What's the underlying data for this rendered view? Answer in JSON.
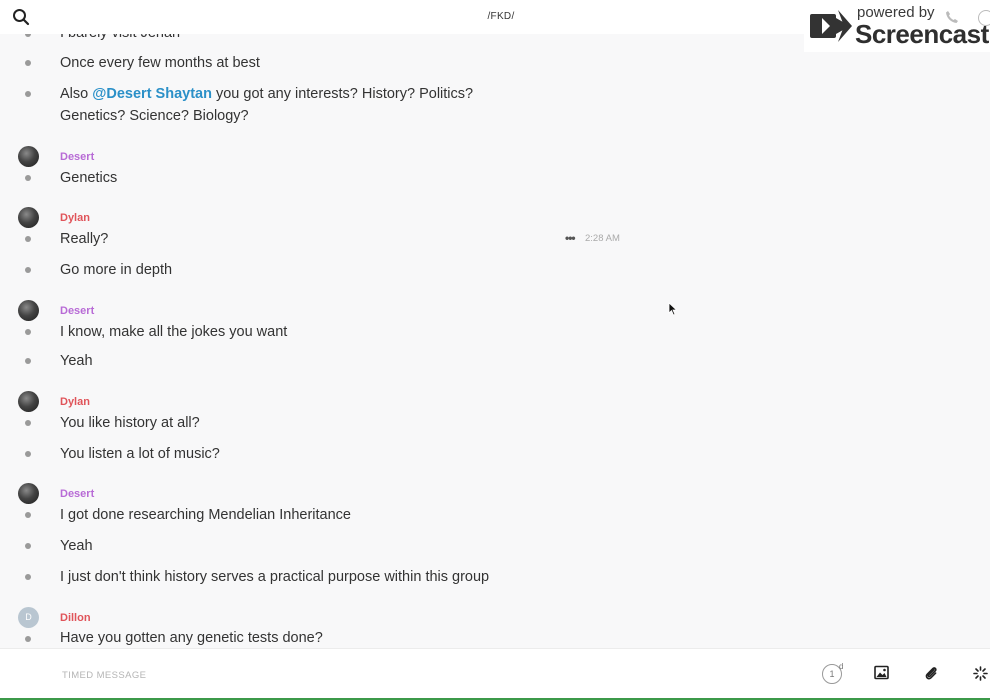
{
  "header": {
    "title": "/FKD/",
    "search_icon": "search-icon"
  },
  "watermark": {
    "line1": "powered by",
    "line2": "Screencastify"
  },
  "hover": {
    "menu": "•••",
    "time": "2:28 AM"
  },
  "messages": [
    {
      "text": "I barely visit Jenah"
    },
    {
      "text": "Once every few months at best"
    },
    {
      "prefix": "Also ",
      "mention": "@Desert Shaytan",
      "suffix": " you got any interests? History? Politics? Genetics? Science? Biology?"
    },
    {
      "author": "Desert",
      "text": "Genetics"
    },
    {
      "author": "Dylan",
      "text": "Really?"
    },
    {
      "text": "Go more in depth"
    },
    {
      "author": "Desert",
      "text": "I know, make all the jokes you want"
    },
    {
      "text": "Yeah"
    },
    {
      "author": "Dylan",
      "text": "You like history at all?"
    },
    {
      "text": "You listen a lot of music?"
    },
    {
      "author": "Desert",
      "text": "I got done researching Mendelian Inheritance"
    },
    {
      "text": "Yeah"
    },
    {
      "text": "I just don't think history serves a practical purpose within this group"
    },
    {
      "author": "Dillon",
      "avatar_letter": "D",
      "text": "Have you gotten any genetic tests done?"
    }
  ],
  "composer": {
    "placeholder": "TIMED MESSAGE",
    "timer_value": "1",
    "timer_unit": "d"
  },
  "colors": {
    "desert": "#b86bd6",
    "dylan": "#e0545a",
    "mention": "#2b90c8"
  }
}
